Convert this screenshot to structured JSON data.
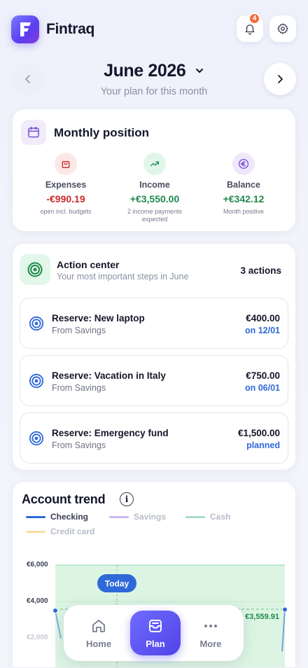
{
  "app": {
    "name": "Fintraq",
    "logo_letter": "F",
    "notification_count": "4"
  },
  "period": {
    "title": "June 2026",
    "subtitle": "Your plan for this month"
  },
  "position": {
    "title": "Monthly position",
    "expenses": {
      "label": "Expenses",
      "value": "-€990.19",
      "note": "open incl. budgets"
    },
    "income": {
      "label": "Income",
      "value": "+€3,550.00",
      "note": "2 income payments expected"
    },
    "balance": {
      "label": "Balance",
      "value": "+€342.12",
      "note": "Month positive"
    }
  },
  "actions": {
    "title": "Action center",
    "subtitle": "Your most important steps in June",
    "count": "3 actions",
    "items": [
      {
        "title": "Reserve: New laptop",
        "source": "From Savings",
        "amount": "€400.00",
        "date": "on 12/01"
      },
      {
        "title": "Reserve: Vacation in Italy",
        "source": "From Savings",
        "amount": "€750.00",
        "date": "on 06/01"
      },
      {
        "title": "Reserve: Emergency fund",
        "source": "From Savings",
        "amount": "€1,500.00",
        "date": "planned"
      }
    ]
  },
  "trend": {
    "title": "Account trend",
    "info": "i",
    "legend": [
      {
        "label": "Checking",
        "color": "#2f69d8",
        "active": true
      },
      {
        "label": "Savings",
        "color": "#c9b8f5",
        "active": false
      },
      {
        "label": "Cash",
        "color": "#a8dcc6",
        "active": false
      },
      {
        "label": "Credit card",
        "color": "#f8dca5",
        "active": false
      }
    ],
    "y_ticks": [
      "€6,000",
      "€4,000",
      "€2,000"
    ],
    "today_label": "Today",
    "end_value": "€3,559.91"
  },
  "chart_data": {
    "type": "line",
    "title": "Account trend",
    "series": [
      {
        "name": "Checking",
        "values": [
          3500,
          3559.91
        ]
      }
    ],
    "ylim": [
      2000,
      6000
    ],
    "annotations": [
      "Today",
      "€3,559.91"
    ],
    "legend_placement": "top"
  },
  "nav": {
    "home": "Home",
    "plan": "Plan",
    "more": "More",
    "active": "Plan"
  },
  "colors": {
    "expense": "#c62b2b",
    "income": "#1f8a4c",
    "accent": "#5143e8",
    "date": "#2f69d8"
  }
}
